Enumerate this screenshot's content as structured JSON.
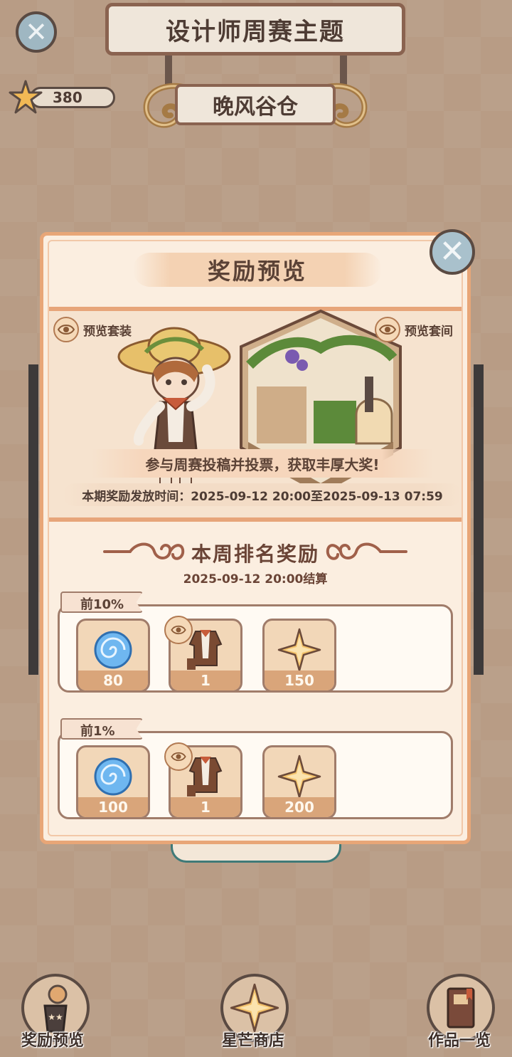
{
  "header": {
    "title": "设计师周赛主题",
    "theme": "晚风谷仓",
    "currency_value": "380"
  },
  "popup": {
    "title": "奖励预览",
    "preview_outfit_label": "预览套装",
    "preview_room_label": "预览套间",
    "banner_text": "参与周赛投稿并投票，获取丰厚大奖!",
    "time_text": "本期奖励发放时间：2025-09-12 20:00至2025-09-13 07:59",
    "rank_title": "本周排名奖励",
    "rank_date": "2025-09-12 20:00结算",
    "tiers": [
      {
        "label": "前10%",
        "items": [
          {
            "icon": "blue-swirl-icon",
            "qty": "80"
          },
          {
            "icon": "outfit-icon",
            "qty": "1"
          },
          {
            "icon": "star-icon",
            "qty": "150"
          }
        ]
      },
      {
        "label": "前1%",
        "items": [
          {
            "icon": "blue-swirl-icon",
            "qty": "100"
          },
          {
            "icon": "outfit-icon",
            "qty": "1"
          },
          {
            "icon": "star-icon",
            "qty": "200"
          }
        ]
      }
    ]
  },
  "nav": {
    "reward_preview": "奖励预览",
    "star_shop": "星芒商店",
    "works_list": "作品一览"
  },
  "colors": {
    "popup_border": "#e8a677",
    "popup_bg": "#fbeee0",
    "item_bg": "#f2d7b8",
    "qty_bar": "#d9a57a",
    "text_dark": "#5b4236"
  }
}
